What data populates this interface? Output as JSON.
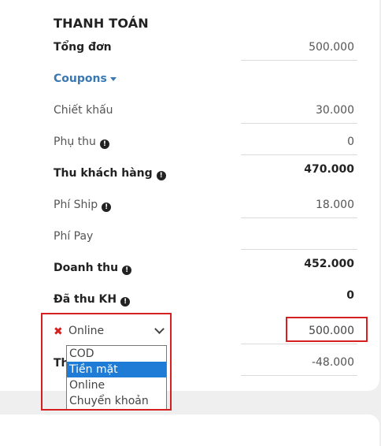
{
  "section_title": "THANH TOÁN",
  "rows": {
    "tong_don": {
      "label": "Tổng đơn",
      "value": "500.000"
    },
    "coupons": {
      "label": "Coupons"
    },
    "chiet_khau": {
      "label": "Chiết khấu",
      "value": "30.000"
    },
    "phu_thu": {
      "label": "Phụ thu",
      "value": "0"
    },
    "thu_khach_hang": {
      "label": "Thu khách hàng",
      "value": "470.000"
    },
    "phi_ship": {
      "label": "Phí Ship",
      "value": "18.000"
    },
    "phi_pay": {
      "label": "Phí Pay",
      "value": ""
    },
    "doanh_thu": {
      "label": "Doanh thu",
      "value": "452.000"
    },
    "da_thu_kh": {
      "label": "Đã thu KH",
      "value": "0"
    }
  },
  "payment": {
    "method_selected": "Online",
    "amount": "500.000",
    "options": [
      "COD",
      "Tiền mặt",
      "Online",
      "Chuyển khoản"
    ],
    "highlighted_option": "Tiền mặt"
  },
  "last_row": {
    "label_partial": "Th",
    "value": "-48.000"
  },
  "icons": {
    "info": "info-circle-icon",
    "remove": "close-x-icon",
    "dropdown": "chevron-down-icon"
  },
  "colors": {
    "accent_link": "#3a78b4",
    "highlight_box": "#d62020",
    "option_selected": "#1e7bd6"
  }
}
